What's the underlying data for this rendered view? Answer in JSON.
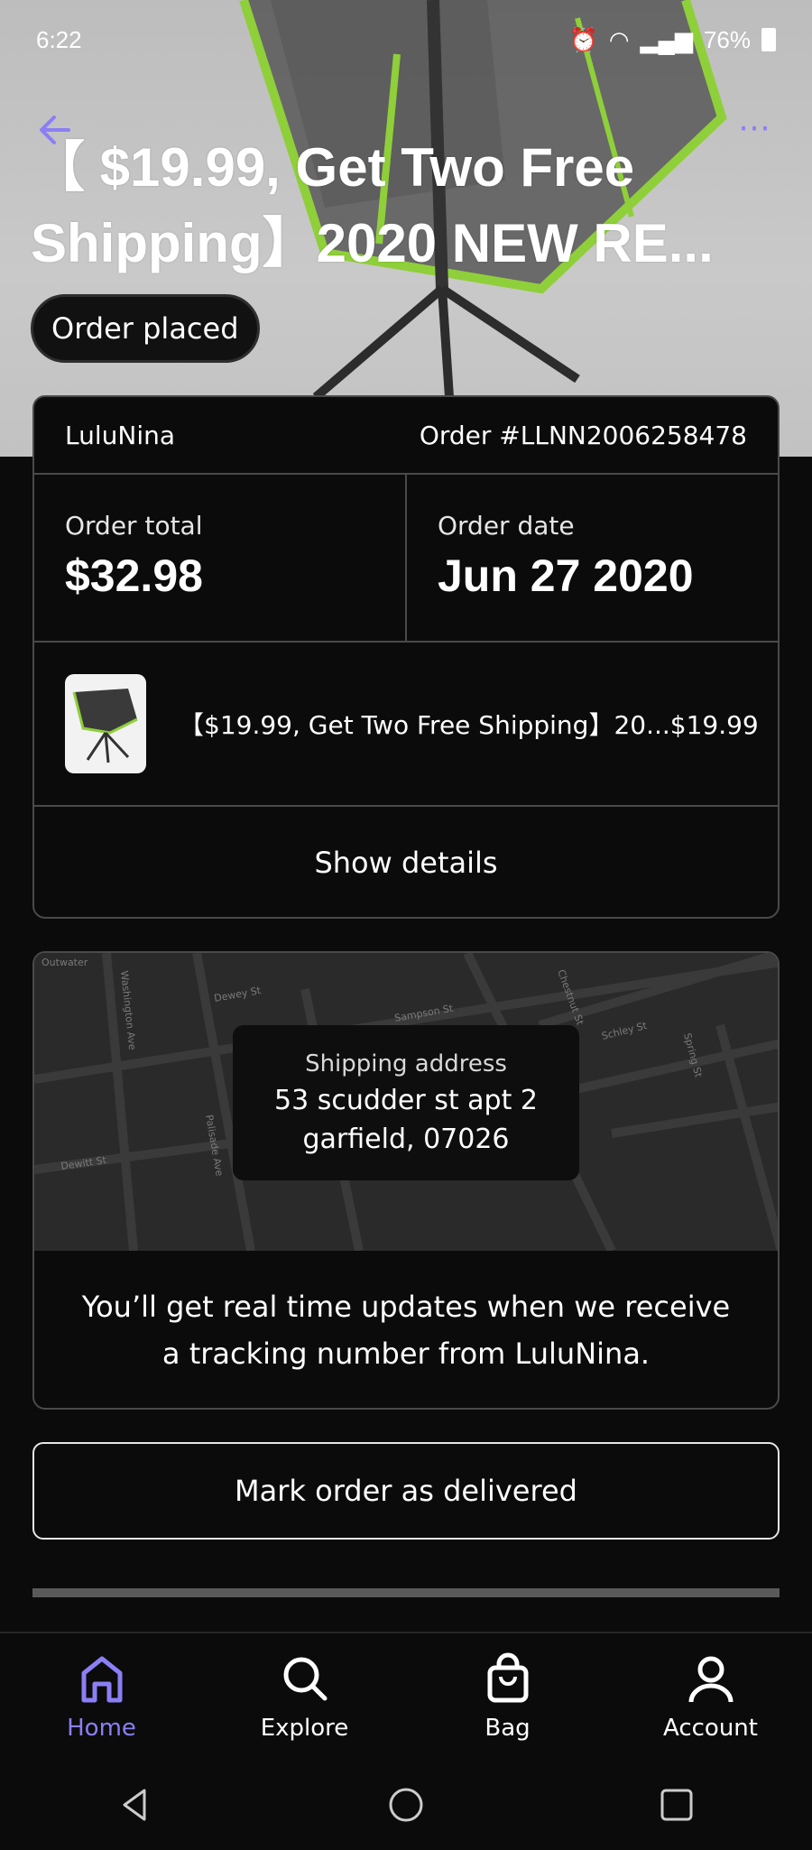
{
  "status_bar": {
    "time": "6:22",
    "battery": "76%"
  },
  "header": {
    "title_line1": "【 $19.99, Get Two Free",
    "title_line2": "Shipping】2020 NEW RE...",
    "status_pill": "Order placed"
  },
  "order": {
    "seller": "LuluNina",
    "order_number": "Order #LLNN2006258478",
    "total_label": "Order total",
    "total_value": "$32.98",
    "date_label": "Order date",
    "date_value": "Jun 27 2020",
    "item_text": "【$19.99, Get Two Free Shipping】20...$19.99",
    "show_details": "Show details"
  },
  "shipping": {
    "label": "Shipping address",
    "line1": "53 scudder st apt 2",
    "line2": "garfield, 07026",
    "map_streets": [
      "Outwater",
      "Washington Ave",
      "Dewey St",
      "Sampson St",
      "Chestnut St",
      "Schley St",
      "Palisade Ave",
      "Dewitt St",
      "Spring St"
    ],
    "updates_msg": "You’ll get real time updates when we receive a tracking number from LuluNina."
  },
  "actions": {
    "mark_delivered": "Mark order as delivered"
  },
  "nav": {
    "home": "Home",
    "explore": "Explore",
    "bag": "Bag",
    "account": "Account"
  },
  "colors": {
    "accent": "#8b7ff5",
    "background": "#0b0b0b",
    "border": "#4a4a4a"
  }
}
